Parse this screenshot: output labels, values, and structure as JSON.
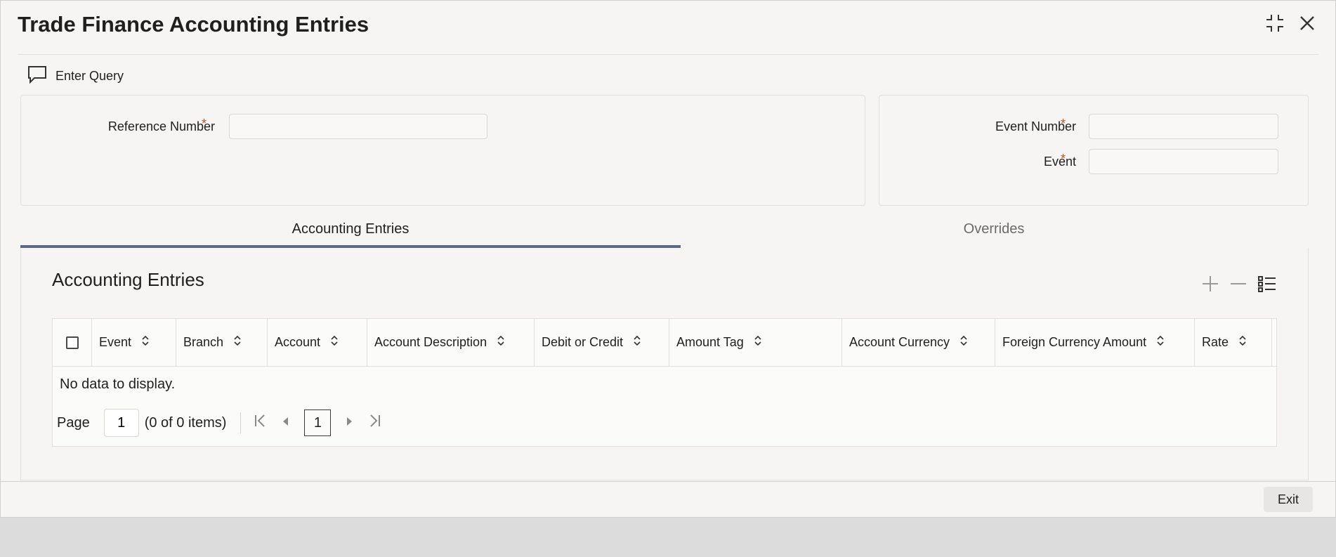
{
  "window": {
    "title": "Trade Finance Accounting Entries"
  },
  "toolbar": {
    "enter_query_label": "Enter Query"
  },
  "header_form": {
    "reference_number": {
      "label": "Reference Number",
      "required_mark": "*",
      "value": ""
    },
    "event_number": {
      "label": "Event Number",
      "required_mark": "*",
      "value": ""
    },
    "event": {
      "label": "Event",
      "required_mark": "*",
      "value": ""
    }
  },
  "tabs": [
    {
      "label": "Accounting Entries",
      "active": true
    },
    {
      "label": "Overrides",
      "active": false
    }
  ],
  "section": {
    "title": "Accounting Entries"
  },
  "table": {
    "columns": [
      "Event",
      "Branch",
      "Account",
      "Account Description",
      "Debit or Credit",
      "Amount Tag",
      "Account Currency",
      "Foreign Currency Amount",
      "Rate"
    ],
    "empty_message": "No data to display."
  },
  "pagination": {
    "page_label": "Page",
    "page_value": "1",
    "items_summary": "(0 of 0 items)",
    "current_page": "1"
  },
  "footer": {
    "exit_label": "Exit"
  },
  "colors": {
    "accent": "#5c6685",
    "required": "#c4541b"
  },
  "icons": [
    "chat-icon",
    "maximize-icon",
    "close-icon",
    "add-row-icon",
    "delete-row-icon",
    "column-list-icon",
    "sort-icon",
    "first-page-icon",
    "prev-page-icon",
    "next-page-icon",
    "last-page-icon"
  ]
}
